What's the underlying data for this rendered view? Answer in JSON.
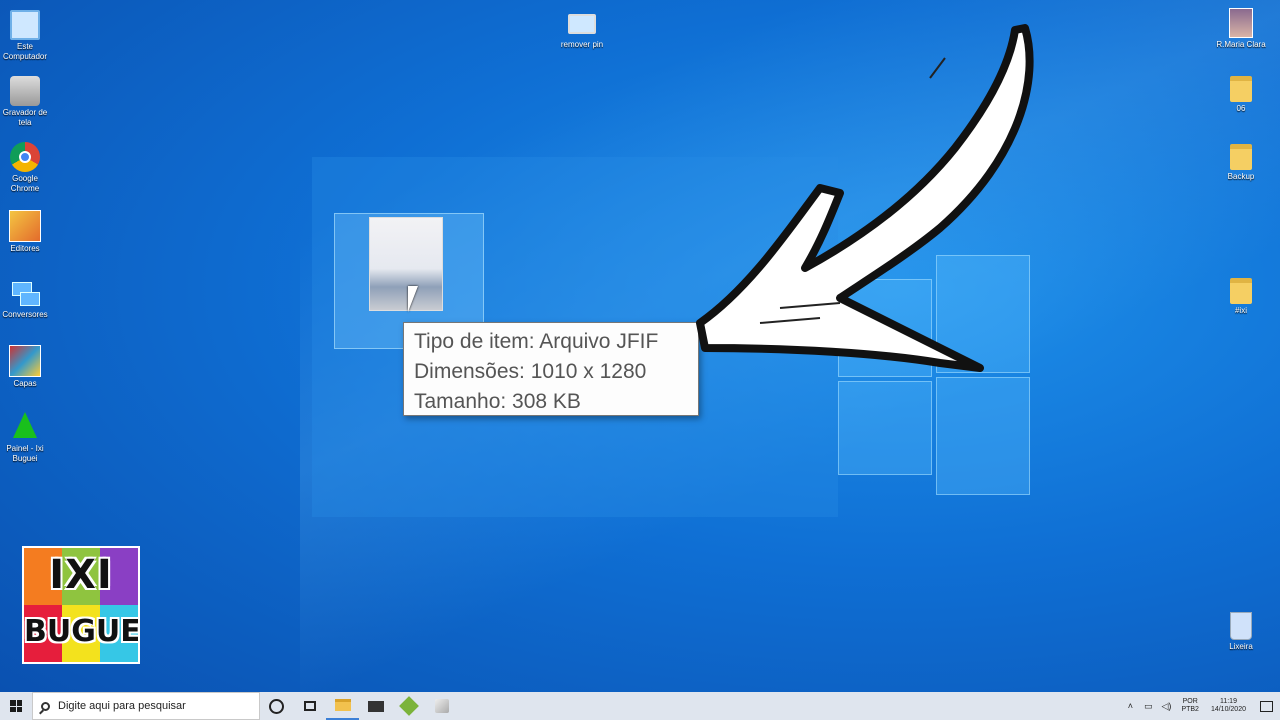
{
  "desktop_left": [
    {
      "label": "Este\nComputador",
      "icon": "computer-icon"
    },
    {
      "label": "Gravador de\ntela",
      "icon": "screen-recorder-icon"
    },
    {
      "label": "Google\nChrome",
      "icon": "chrome-icon"
    },
    {
      "label": "Editores",
      "icon": "editors-icon"
    },
    {
      "label": "Conversores",
      "icon": "converters-icon"
    },
    {
      "label": "Capas",
      "icon": "covers-icon"
    },
    {
      "label": "Painel - Ixi\nBuguei",
      "icon": "panel-shortcut-icon"
    }
  ],
  "desktop_top": {
    "label": "remover pin",
    "icon": "remover-pin-icon"
  },
  "desktop_right": [
    {
      "label": "R.Maria Clara",
      "icon": "photo-file-icon"
    },
    {
      "label": "06",
      "icon": "folder-icon"
    },
    {
      "label": "Backup",
      "icon": "folder-icon"
    },
    {
      "label": "#ixi",
      "icon": "folder-icon"
    },
    {
      "label": "Lixeira",
      "icon": "recycle-bin-icon"
    }
  ],
  "tooltip": {
    "line1": "Tipo de item: Arquivo JFIF",
    "line2": "Dimensões: 1010 x 1280",
    "line3": "Tamanho: 308 KB"
  },
  "logo": {
    "line1": "IXI",
    "line2": "BUGUEI"
  },
  "taskbar": {
    "search_placeholder": "Digite aqui para pesquisar",
    "lang_top": "POR",
    "lang_bottom": "PTB2",
    "time": "11:19",
    "date": "14/10/2020"
  },
  "colors": {
    "desktop": "#0f6fd4",
    "taskbar": "#dfe5ee",
    "arrow": "#ffffff"
  }
}
